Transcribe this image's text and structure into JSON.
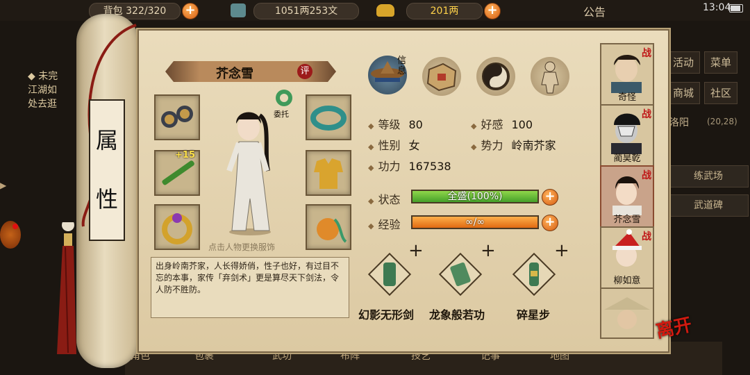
{
  "topbar": {
    "bag_label": "背包",
    "bag_count": "322/320",
    "money": "1051两253文",
    "ingot": "201两",
    "announcement": "公告",
    "time": "13:04"
  },
  "background": {
    "quest_title": "◆ 未完",
    "quest_line1": "江湖如",
    "quest_line2": "处去逛",
    "menu": [
      "活动",
      "菜单",
      "商城",
      "社区"
    ],
    "location": "洛阳",
    "coords": "(20,28)",
    "side_items": [
      "练武场",
      "武道碑"
    ]
  },
  "scroll_tab": [
    "属",
    "性"
  ],
  "character": {
    "name": "芥念雪",
    "rate_badge": "评",
    "commission_label": "委托",
    "weapon_plus": "+15",
    "hint": "点击人物更换服饰",
    "description": "出身岭南芥家，人长得娇俏，性子也好，有过目不忘的本事，家传「弃剑术」更是算尽天下剑法，令人防不胜防。"
  },
  "tabs": [
    {
      "name": "信息",
      "icon": "hat-icon"
    },
    {
      "name": "",
      "icon": "map-icon"
    },
    {
      "name": "",
      "icon": "taiji-icon"
    },
    {
      "name": "",
      "icon": "body-icon"
    }
  ],
  "stats": {
    "level_label": "等级",
    "level": "80",
    "favor_label": "好感",
    "favor": "100",
    "gender_label": "性别",
    "gender": "女",
    "faction_label": "势力",
    "faction": "岭南芥家",
    "power_label": "功力",
    "power": "167538",
    "status_label": "状态",
    "status_value": "全盛(100%)",
    "status_fraction": 1.0,
    "exp_label": "经验",
    "exp_value": "∞/∞",
    "exp_fraction": 1.0
  },
  "skills": [
    {
      "name": "幻影无形剑"
    },
    {
      "name": "龙象般若功"
    },
    {
      "name": "碎星步"
    }
  ],
  "party": [
    {
      "name": "奇怪",
      "tag": "战"
    },
    {
      "name": "蔺昊乾",
      "tag": "战"
    },
    {
      "name": "芥念雪",
      "tag": "战"
    },
    {
      "name": "柳如意",
      "tag": "战"
    },
    {
      "name": "",
      "tag": ""
    }
  ],
  "leave_label": "离开",
  "bottom": [
    "角色",
    "包裹",
    "武功",
    "布阵",
    "技艺",
    "记事",
    "地图"
  ],
  "colors": {
    "paper": "#e3d4b2",
    "green_bar": "#5cb830",
    "orange_bar": "#f08a24",
    "accent_red": "#c01818"
  }
}
